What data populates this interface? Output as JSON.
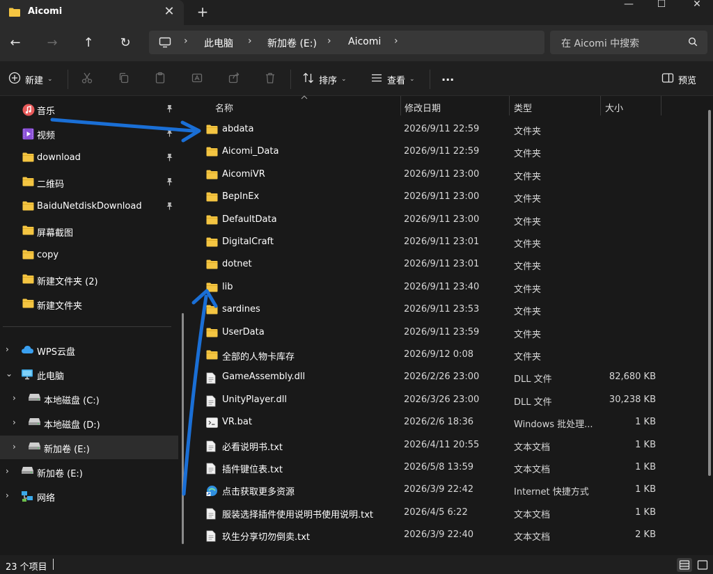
{
  "window": {
    "tab_title": "Aicomi",
    "tab_close": "✕",
    "new_tab": "+",
    "minimize": "—",
    "maximize": "☐",
    "close": "✕"
  },
  "nav": {
    "back": "←",
    "forward": "→",
    "up": "↑",
    "refresh": "↻",
    "breadcrumb": [
      "此电脑",
      "新加卷 (E:)",
      "Aicomi"
    ],
    "chevron": "›",
    "search_placeholder": "在 Aicomi 中搜索"
  },
  "toolbar": {
    "new_label": "新建",
    "sort_label": "排序",
    "view_label": "查看",
    "more_label": "···",
    "preview_label": "预览",
    "caret": "⌄"
  },
  "sidebar": {
    "quick": [
      {
        "label": "音乐",
        "icon": "music-icon",
        "pinned": true
      },
      {
        "label": "视频",
        "icon": "video-icon",
        "pinned": true
      },
      {
        "label": "download",
        "icon": "folder-icon",
        "pinned": true
      },
      {
        "label": "二维码",
        "icon": "folder-icon",
        "pinned": true
      },
      {
        "label": "BaiduNetdiskDownload",
        "icon": "folder-icon",
        "pinned": true
      },
      {
        "label": "屏幕截图",
        "icon": "folder-icon",
        "pinned": false
      },
      {
        "label": "copy",
        "icon": "folder-icon",
        "pinned": false
      },
      {
        "label": "新建文件夹 (2)",
        "icon": "folder-icon",
        "pinned": false
      },
      {
        "label": "新建文件夹",
        "icon": "folder-icon",
        "pinned": false
      }
    ],
    "pin_glyph": "📌",
    "tree": [
      {
        "label": "WPS云盘",
        "icon": "cloud-icon",
        "chevron": "›",
        "indent": 0
      },
      {
        "label": "此电脑",
        "icon": "pc-icon",
        "chevron": "⌄",
        "indent": 0
      },
      {
        "label": "本地磁盘 (C:)",
        "icon": "drive-icon",
        "chevron": "›",
        "indent": 1
      },
      {
        "label": "本地磁盘 (D:)",
        "icon": "drive-icon",
        "chevron": "›",
        "indent": 1
      },
      {
        "label": "新加卷 (E:)",
        "icon": "drive-icon",
        "chevron": "›",
        "indent": 1,
        "selected": true
      },
      {
        "label": "新加卷 (E:)",
        "icon": "drive-icon",
        "chevron": "›",
        "indent": 0
      },
      {
        "label": "网络",
        "icon": "network-icon",
        "chevron": "›",
        "indent": 0
      }
    ]
  },
  "columns": {
    "name": "名称",
    "date": "修改日期",
    "type": "类型",
    "size": "大小"
  },
  "files": [
    {
      "name": "abdata",
      "date": "2026/9/11 22:59",
      "type": "文件夹",
      "size": "",
      "icon": "folder-icon"
    },
    {
      "name": "Aicomi_Data",
      "date": "2026/9/11 22:59",
      "type": "文件夹",
      "size": "",
      "icon": "folder-icon"
    },
    {
      "name": "AicomiVR",
      "date": "2026/9/11 23:00",
      "type": "文件夹",
      "size": "",
      "icon": "folder-icon"
    },
    {
      "name": "BepInEx",
      "date": "2026/9/11 23:00",
      "type": "文件夹",
      "size": "",
      "icon": "folder-icon"
    },
    {
      "name": "DefaultData",
      "date": "2026/9/11 23:00",
      "type": "文件夹",
      "size": "",
      "icon": "folder-icon"
    },
    {
      "name": "DigitalCraft",
      "date": "2026/9/11 23:01",
      "type": "文件夹",
      "size": "",
      "icon": "folder-icon"
    },
    {
      "name": "dotnet",
      "date": "2026/9/11 23:01",
      "type": "文件夹",
      "size": "",
      "icon": "folder-icon"
    },
    {
      "name": "lib",
      "date": "2026/9/11 23:40",
      "type": "文件夹",
      "size": "",
      "icon": "folder-icon"
    },
    {
      "name": "sardines",
      "date": "2026/9/11 23:53",
      "type": "文件夹",
      "size": "",
      "icon": "folder-icon"
    },
    {
      "name": "UserData",
      "date": "2026/9/11 23:59",
      "type": "文件夹",
      "size": "",
      "icon": "folder-icon"
    },
    {
      "name": "全部的人物卡库存",
      "date": "2026/9/12 0:08",
      "type": "文件夹",
      "size": "",
      "icon": "folder-icon"
    },
    {
      "name": "GameAssembly.dll",
      "date": "2026/2/26 23:00",
      "type": "DLL 文件",
      "size": "82,680 KB",
      "icon": "file-icon"
    },
    {
      "name": "UnityPlayer.dll",
      "date": "2026/3/26 23:00",
      "type": "DLL 文件",
      "size": "30,238 KB",
      "icon": "file-icon"
    },
    {
      "name": "VR.bat",
      "date": "2026/2/6 18:36",
      "type": "Windows 批处理...",
      "size": "1 KB",
      "icon": "bat-icon"
    },
    {
      "name": "必看说明书.txt",
      "date": "2026/4/11 20:55",
      "type": "文本文档",
      "size": "1 KB",
      "icon": "file-icon"
    },
    {
      "name": "插件键位表.txt",
      "date": "2026/5/8 13:59",
      "type": "文本文档",
      "size": "1 KB",
      "icon": "file-icon"
    },
    {
      "name": "点击获取更多资源",
      "date": "2026/3/9 22:42",
      "type": "Internet 快捷方式",
      "size": "1 KB",
      "icon": "shortcut-icon"
    },
    {
      "name": "服装选择插件使用说明书使用说明.txt",
      "date": "2026/4/5 6:22",
      "type": "文本文档",
      "size": "1 KB",
      "icon": "file-icon"
    },
    {
      "name": "玖生分享切勿倒卖.txt",
      "date": "2026/3/9 22:40",
      "type": "文本文档",
      "size": "2 KB",
      "icon": "file-icon"
    }
  ],
  "status": {
    "count": "23 个项目"
  },
  "colors": {
    "folder": "#f4c542",
    "arrow": "#1a6fd6",
    "accent": "#4cc2ff"
  }
}
